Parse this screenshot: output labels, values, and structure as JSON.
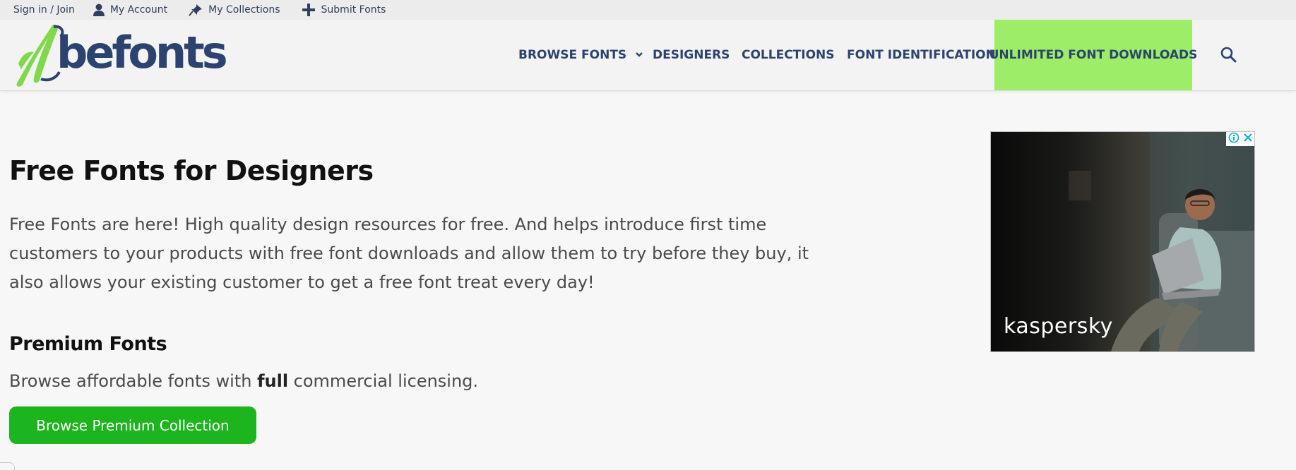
{
  "topbar": {
    "signin": "Sign in / Join",
    "account": "My Account",
    "collections": "My Collections",
    "submit": "Submit Fonts"
  },
  "logo": {
    "text": "befonts"
  },
  "nav": {
    "browse": "BROWSE FONTS",
    "designers": "DESIGNERS",
    "collections": "COLLECTIONS",
    "identification": "FONT IDENTIFICATION",
    "unlimited": "UNLIMITED FONT DOWNLOADS"
  },
  "main": {
    "title": "Free Fonts for Designers",
    "intro": "Free Fonts are here! High quality design resources for free. And helps introduce first time customers to your products with free font downloads and allow them to try before they buy, it also allows your existing customer to get a free font treat every day!",
    "premium_title": "Premium Fonts",
    "premium_pre": "Browse affordable fonts with ",
    "premium_bold": "full",
    "premium_post": " commercial licensing.",
    "cta": "Browse Premium Collection"
  },
  "ad": {
    "brand": "kaspersky"
  },
  "colors": {
    "brand_navy": "#2c4370",
    "logo_green": "#7fd94a",
    "nav_highlight": "#9ded68",
    "cta_green": "#1db51d"
  },
  "icons": [
    "user-icon",
    "pin-icon",
    "plus-icon",
    "chevron-down-icon",
    "search-icon",
    "adchoices-icon",
    "close-icon"
  ]
}
